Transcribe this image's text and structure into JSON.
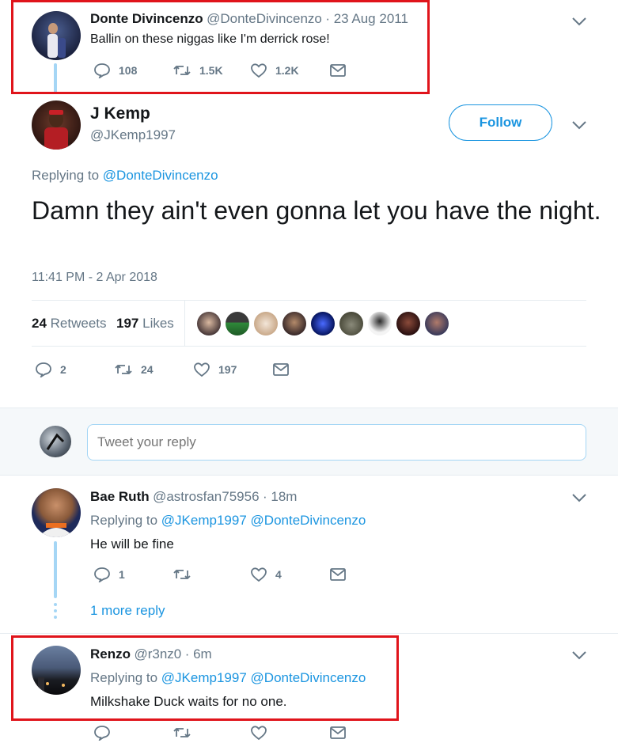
{
  "parent_tweet": {
    "name": "Donte Divincenzo",
    "handle": "@DonteDivincenzo",
    "date": "· 23 Aug 2011",
    "text": "Ballin on these niggas like I'm derrick rose!",
    "replies": "108",
    "retweets": "1.5K",
    "likes": "1.2K"
  },
  "main_tweet": {
    "name": "J Kemp",
    "handle": "@JKemp1997",
    "follow_label": "Follow",
    "replying_prefix": "Replying to",
    "replying_to": "@DonteDivincenzo",
    "text": "Damn they ain't even gonna let you have the night.",
    "timestamp": "11:41 PM - 2 Apr 2018",
    "retweets_count": "24",
    "retweets_label": "Retweets",
    "likes_count": "197",
    "likes_label": "Likes",
    "action_replies": "2",
    "action_retweets": "24",
    "action_likes": "197"
  },
  "reply_box": {
    "placeholder": "Tweet your reply"
  },
  "replies": [
    {
      "name": "Bae Ruth",
      "handle": "@astrosfan75956",
      "time": "· 18m",
      "replying_prefix": "Replying to",
      "replying_to_1": "@JKemp1997",
      "replying_to_2": "@DonteDivincenzo",
      "text": "He will be fine",
      "replies": "1",
      "likes": "4",
      "more_reply": "1 more reply"
    },
    {
      "name": "Renzo",
      "handle": "@r3nz0",
      "time": "· 6m",
      "replying_prefix": "Replying to",
      "replying_to_1": "@JKemp1997",
      "replying_to_2": "@DonteDivincenzo",
      "text": "Milkshake Duck waits for no one."
    }
  ],
  "colors": {
    "accent": "#1b95e0",
    "highlight_box": "#e0141b",
    "muted": "#657786"
  }
}
